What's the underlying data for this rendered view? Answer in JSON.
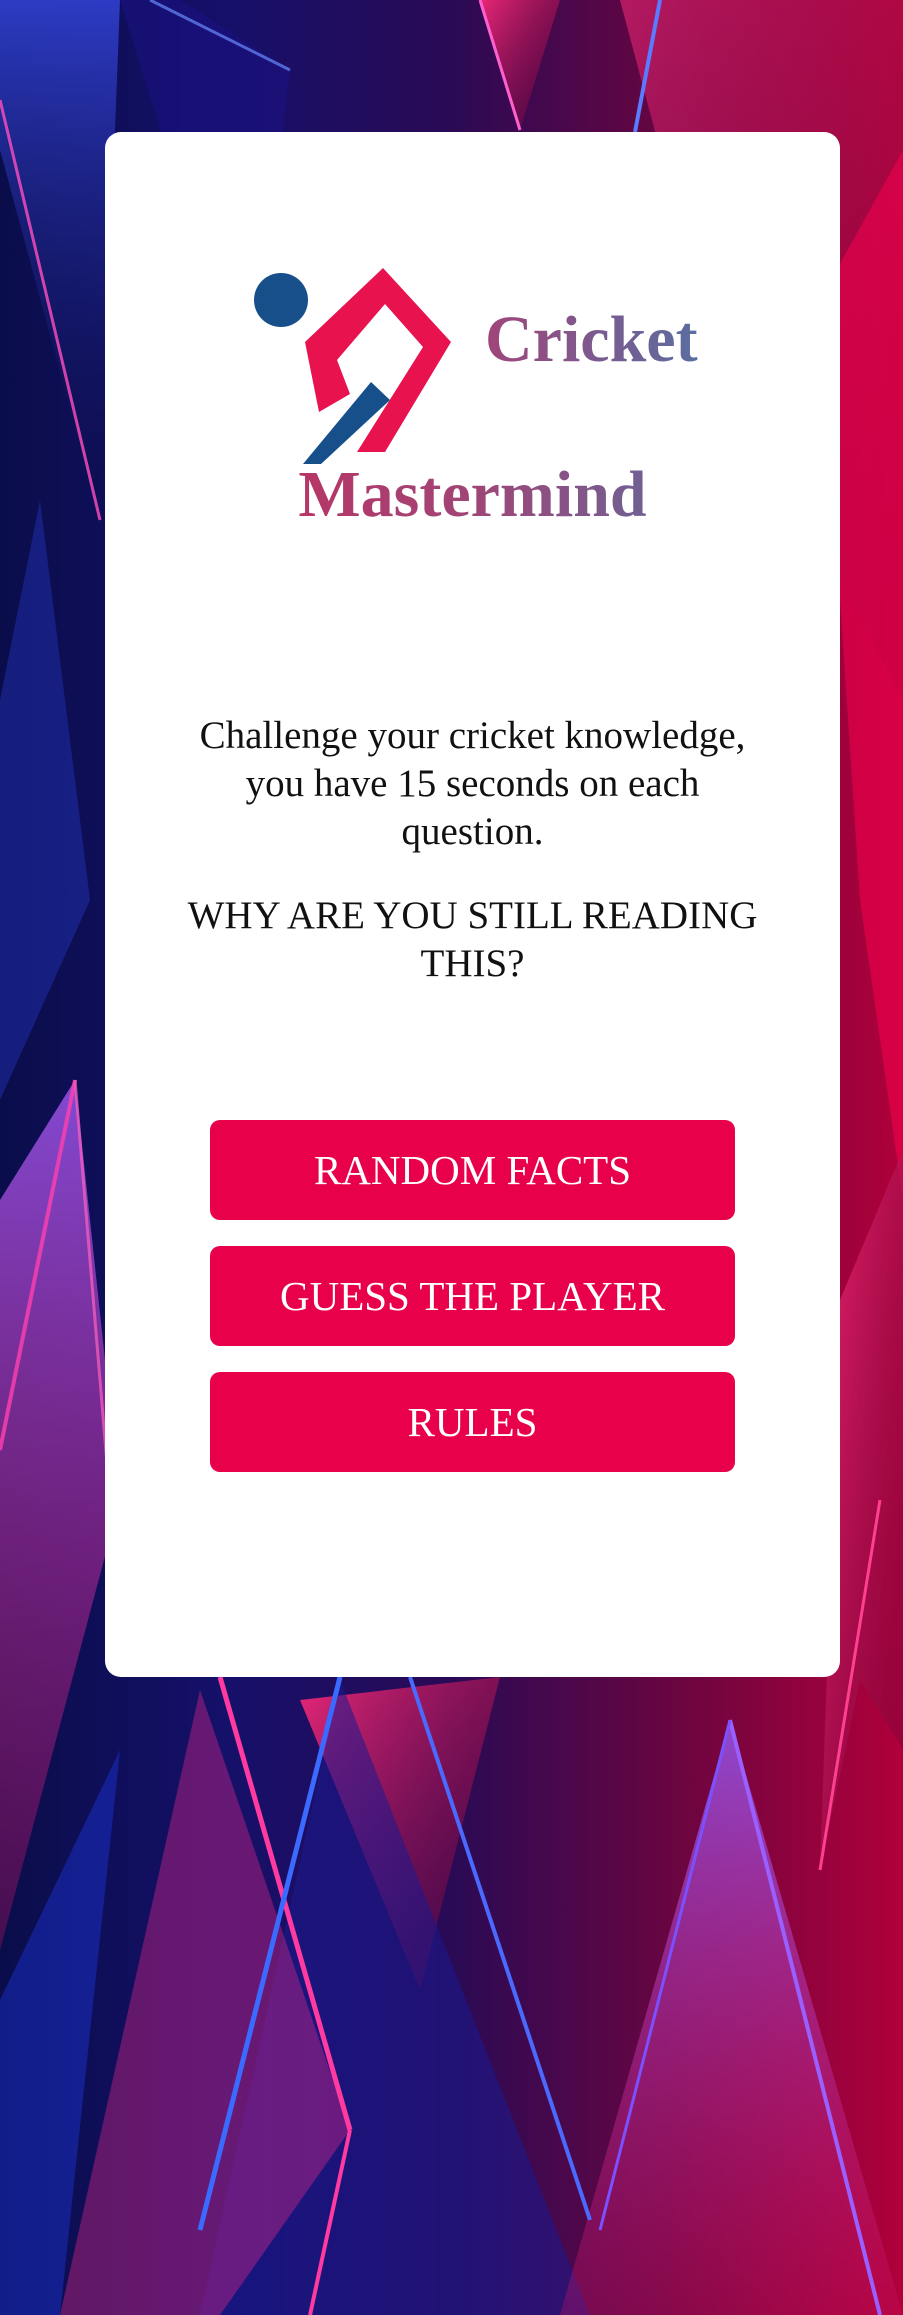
{
  "app": {
    "title_line1": "Cricket",
    "title_line2": "Mastermind"
  },
  "intro": {
    "description": "Challenge your cricket knowledge, you have 15 seconds on each question.",
    "shout": "WHY ARE YOU STILL READING THIS?"
  },
  "menu": {
    "random_facts_label": "RANDOM FACTS",
    "guess_player_label": "GUESS THE PLAYER",
    "rules_label": "RULES"
  },
  "colors": {
    "button": "#e8004a",
    "logo_red": "#e8124f",
    "logo_blue": "#174f8a",
    "card": "#ffffff"
  },
  "icons": {
    "logo": "cricket-batsman-logo"
  }
}
